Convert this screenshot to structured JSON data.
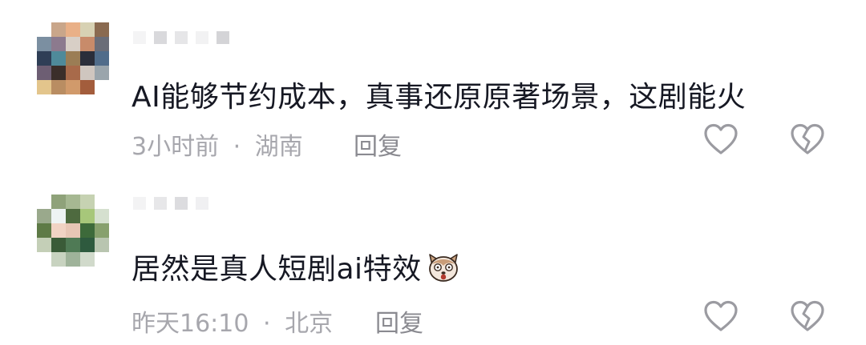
{
  "comments": [
    {
      "text": "AI能够节约成本，真事还原原著场景，这剧能火",
      "time": "3小时前",
      "separator": "·",
      "location": "湖南",
      "reply": "回复",
      "avatar_colors": [
        "#ffffff",
        "#c9a68a",
        "#e9b087",
        "#d7d1b3",
        "#8a6a50",
        "#7b8fa1",
        "#8c7a8e",
        "#d8cfc6",
        "#c88b6a",
        "#6a6d78",
        "#2f3e56",
        "#4f8a9a",
        "#9b7d55",
        "#2b2e3a",
        "#506c8a",
        "#6d5e73",
        "#3b2e2a",
        "#a86a4a",
        "#cfc6bf",
        "#9aa5ac",
        "#e3c58c",
        "#b98d62",
        "#d19a6b",
        "#a35d3c",
        "#ffffff"
      ],
      "icons": {
        "like": "heart-outline-icon",
        "dislike": "broken-heart-outline-icon"
      }
    },
    {
      "text": "居然是真人短剧ai特效",
      "time": "昨天16:10",
      "separator": "·",
      "location": "北京",
      "reply": "回复",
      "emoji": "surprised-dog-emoji",
      "avatar_colors": [
        "#ffffff",
        "#8fa27a",
        "#a6b892",
        "#c6d2b2",
        "#ffffff",
        "#9aa98c",
        "#eef3f3",
        "#4e6a3f",
        "#a7c77a",
        "#d5e0cf",
        "#5e7a46",
        "#f1d3c4",
        "#e7c6b5",
        "#3d6a3a",
        "#87a06d",
        "#c4cfb7",
        "#3a5b38",
        "#4f7a55",
        "#2e5a3e",
        "#b9c5b0",
        "#ffffff",
        "#c8d3c0",
        "#9fb39a",
        "#d1dacb",
        "#ffffff"
      ],
      "icons": {
        "like": "heart-outline-icon",
        "dislike": "broken-heart-outline-icon"
      }
    }
  ],
  "colors": {
    "text": "#161823",
    "meta": "#a7a7ad",
    "icon": "#9b9ba1"
  }
}
